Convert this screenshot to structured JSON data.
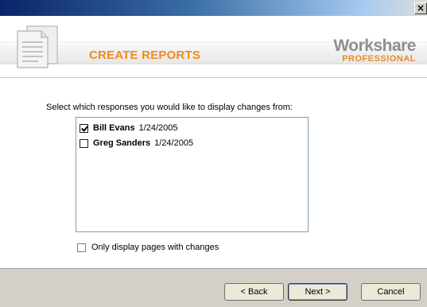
{
  "window": {
    "close_glyph": "×"
  },
  "header": {
    "title": "CREATE REPORTS",
    "icon": "document-stack-icon",
    "brand_name": "Workshare",
    "brand_tag": "PROFESSIONAL",
    "accent_color": "#f08a1c",
    "brand_gray": "#8f8f8f"
  },
  "main": {
    "prompt": "Select which responses you would like to display changes from:",
    "responses": [
      {
        "name": "Bill Evans",
        "date": "1/24/2005",
        "checked": true
      },
      {
        "name": "Greg Sanders",
        "date": "1/24/2005",
        "checked": false
      }
    ],
    "only_changes_label": "Only display pages with changes",
    "only_changes_checked": false
  },
  "footer": {
    "back_label": "< Back",
    "next_label": "Next >",
    "cancel_label": "Cancel"
  }
}
